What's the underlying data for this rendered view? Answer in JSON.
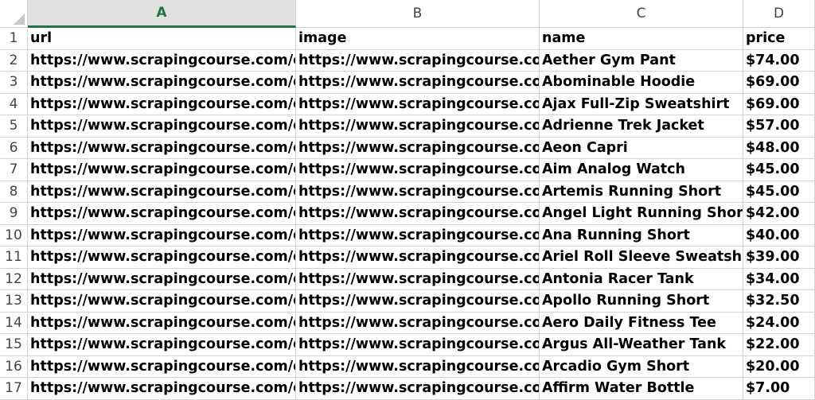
{
  "columns": [
    {
      "letter": "A",
      "active": true
    },
    {
      "letter": "B",
      "active": false
    },
    {
      "letter": "C",
      "active": false
    },
    {
      "letter": "D",
      "active": false
    }
  ],
  "rows": [
    {
      "num": "1",
      "cells": [
        "url",
        "image",
        "name",
        "price"
      ]
    },
    {
      "num": "2",
      "cells": [
        "https://www.scrapingcourse.com/ec",
        "https://www.scrapingcourse.com,",
        "Aether Gym Pant",
        "$74.00"
      ]
    },
    {
      "num": "3",
      "cells": [
        "https://www.scrapingcourse.com/ec",
        "https://www.scrapingcourse.com,",
        "Abominable Hoodie",
        "$69.00"
      ]
    },
    {
      "num": "4",
      "cells": [
        "https://www.scrapingcourse.com/ec",
        "https://www.scrapingcourse.com,",
        "Ajax Full-Zip Sweatshirt",
        "$69.00"
      ]
    },
    {
      "num": "5",
      "cells": [
        "https://www.scrapingcourse.com/ec",
        "https://www.scrapingcourse.com,",
        "Adrienne Trek Jacket",
        "$57.00"
      ]
    },
    {
      "num": "6",
      "cells": [
        "https://www.scrapingcourse.com/ec",
        "https://www.scrapingcourse.com,",
        "Aeon Capri",
        "$48.00"
      ]
    },
    {
      "num": "7",
      "cells": [
        "https://www.scrapingcourse.com/ec",
        "https://www.scrapingcourse.com,",
        "Aim Analog Watch",
        "$45.00"
      ]
    },
    {
      "num": "8",
      "cells": [
        "https://www.scrapingcourse.com/ec",
        "https://www.scrapingcourse.com,",
        "Artemis Running Short",
        "$45.00"
      ]
    },
    {
      "num": "9",
      "cells": [
        "https://www.scrapingcourse.com/ec",
        "https://www.scrapingcourse.com,",
        "Angel Light Running Short",
        "$42.00"
      ]
    },
    {
      "num": "10",
      "cells": [
        "https://www.scrapingcourse.com/ec",
        "https://www.scrapingcourse.com,",
        "Ana Running Short",
        "$40.00"
      ]
    },
    {
      "num": "11",
      "cells": [
        "https://www.scrapingcourse.com/ec",
        "https://www.scrapingcourse.com,",
        "Ariel Roll Sleeve Sweatshirt",
        "$39.00"
      ]
    },
    {
      "num": "12",
      "cells": [
        "https://www.scrapingcourse.com/ec",
        "https://www.scrapingcourse.com,",
        "Antonia Racer Tank",
        "$34.00"
      ]
    },
    {
      "num": "13",
      "cells": [
        "https://www.scrapingcourse.com/ec",
        "https://www.scrapingcourse.com,",
        "Apollo Running Short",
        "$32.50"
      ]
    },
    {
      "num": "14",
      "cells": [
        "https://www.scrapingcourse.com/ec",
        "https://www.scrapingcourse.com,",
        "Aero Daily Fitness Tee",
        "$24.00"
      ]
    },
    {
      "num": "15",
      "cells": [
        "https://www.scrapingcourse.com/ec",
        "https://www.scrapingcourse.com,",
        "Argus All-Weather Tank",
        "$22.00"
      ]
    },
    {
      "num": "16",
      "cells": [
        "https://www.scrapingcourse.com/ec",
        "https://www.scrapingcourse.com,",
        "Arcadio Gym Short",
        "$20.00"
      ]
    },
    {
      "num": "17",
      "cells": [
        "https://www.scrapingcourse.com/ec",
        "https://www.scrapingcourse.com,",
        "Affirm Water Bottle",
        "$7.00"
      ]
    }
  ],
  "colors": {
    "accent": "#217346",
    "gridline": "#d4d4d4"
  }
}
